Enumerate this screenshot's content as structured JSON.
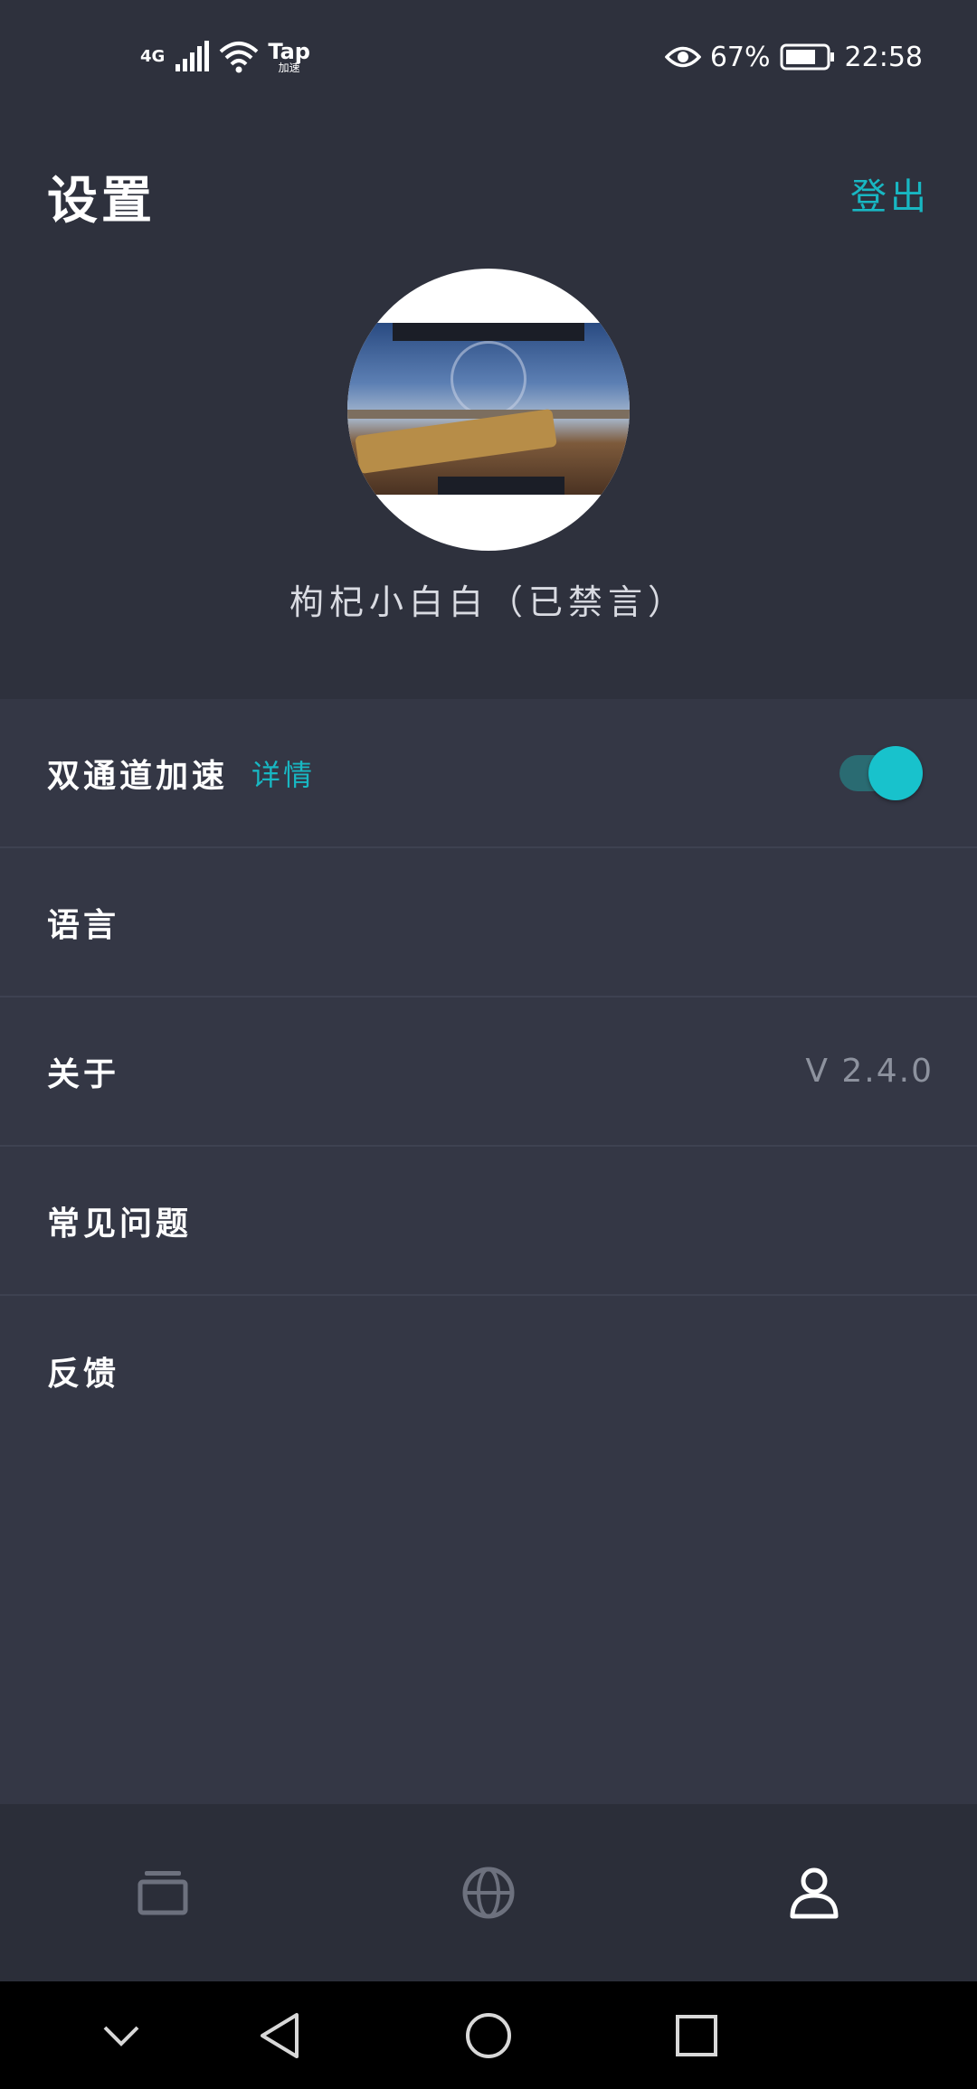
{
  "status_bar": {
    "network": "4G",
    "tap_label": "Tap",
    "tap_sub": "加速",
    "battery_percent": "67%",
    "time": "22:58"
  },
  "header": {
    "title": "设置",
    "logout_label": "登出"
  },
  "profile": {
    "username": "枸杞小白白（已禁言）"
  },
  "settings": {
    "dual_channel": {
      "label": "双通道加速",
      "detail_label": "详情",
      "toggle_on": true
    },
    "language": {
      "label": "语言"
    },
    "about": {
      "label": "关于",
      "version": "V 2.4.0"
    },
    "faq": {
      "label": "常见问题"
    },
    "feedback": {
      "label": "反馈"
    }
  },
  "bottom_nav": {
    "items": [
      {
        "icon": "cards-icon",
        "active": false
      },
      {
        "icon": "globe-icon",
        "active": false
      },
      {
        "icon": "person-icon",
        "active": true
      }
    ]
  },
  "colors": {
    "accent": "#18b7c2",
    "background": "#2e313d",
    "list_background": "#343745"
  }
}
